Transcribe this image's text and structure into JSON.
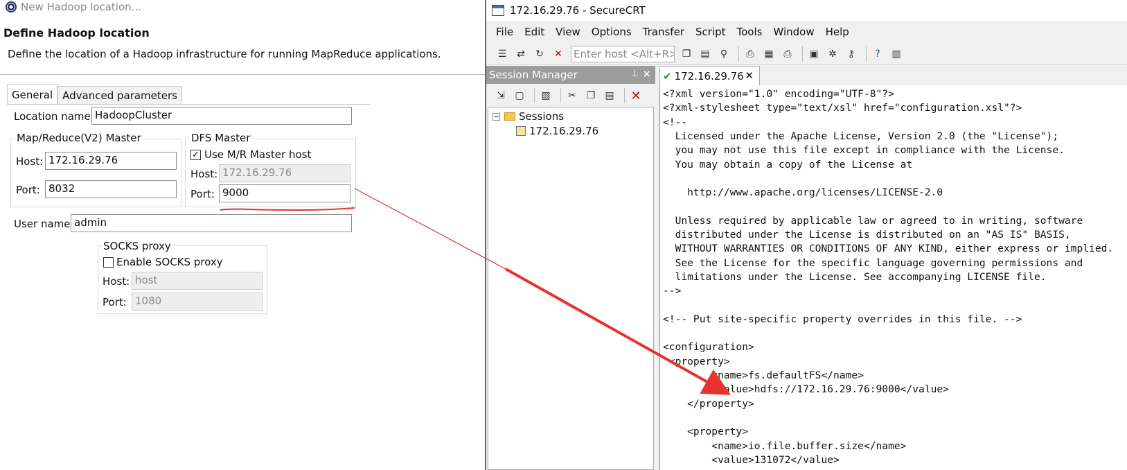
{
  "eclipse_dialog": {
    "window_title": "New Hadoop location...",
    "heading": "Define Hadoop location",
    "description": "Define the location of a Hadoop infrastructure for running MapReduce applications.",
    "tabs": [
      {
        "label": "General",
        "active": true
      },
      {
        "label": "Advanced parameters",
        "active": false
      }
    ],
    "location_name": {
      "label": "Location name:",
      "value": "HadoopCluster"
    },
    "mr_master": {
      "title": "Map/Reduce(V2) Master",
      "host_label": "Host:",
      "host_value": "172.16.29.76",
      "port_label": "Port:",
      "port_value": "8032"
    },
    "dfs_master": {
      "title": "DFS Master",
      "use_mr_label": "Use M/R Master host",
      "use_mr_checked": true,
      "host_label": "Host:",
      "host_value": "172.16.29.76",
      "port_label": "Port:",
      "port_value": "9000"
    },
    "user_name": {
      "label": "User name:",
      "value": "admin"
    },
    "socks_proxy": {
      "title": "SOCKS proxy",
      "enable_label": "Enable SOCKS proxy",
      "enable_checked": false,
      "host_label": "Host:",
      "host_value": "host",
      "port_label": "Port:",
      "port_value": "1080"
    }
  },
  "securecrt": {
    "window_title": "172.16.29.76 - SecureCRT",
    "menus": [
      "File",
      "Edit",
      "View",
      "Options",
      "Transfer",
      "Script",
      "Tools",
      "Window",
      "Help"
    ],
    "host_placeholder": "Enter host <Alt+R>",
    "session_manager": {
      "title": "Session Manager",
      "tree_root": "Sessions",
      "tree_items": [
        "172.16.29.76"
      ]
    },
    "active_tab": "172.16.29.76",
    "terminal_lines": [
      "<?xml version=\"1.0\" encoding=\"UTF-8\"?>",
      "<?xml-stylesheet type=\"text/xsl\" href=\"configuration.xsl\"?>",
      "<!--",
      "  Licensed under the Apache License, Version 2.0 (the \"License\");",
      "  you may not use this file except in compliance with the License.",
      "  You may obtain a copy of the License at",
      "",
      "    http://www.apache.org/licenses/LICENSE-2.0",
      "",
      "  Unless required by applicable law or agreed to in writing, software",
      "  distributed under the License is distributed on an \"AS IS\" BASIS,",
      "  WITHOUT WARRANTIES OR CONDITIONS OF ANY KIND, either express or implied.",
      "  See the License for the specific language governing permissions and",
      "  limitations under the License. See accompanying LICENSE file.",
      "-->",
      "",
      "<!-- Put site-specific property overrides in this file. -->",
      "",
      "<configuration>",
      " <property>",
      "        <name>fs.defaultFS</name>",
      "        <value>hdfs://172.16.29.76:9000</value>",
      "    </property>",
      "",
      "    <property>",
      "        <name>io.file.buffer.size</name>",
      "        <value>131072</value>"
    ]
  },
  "annotation": {
    "color": "#e8322c"
  }
}
